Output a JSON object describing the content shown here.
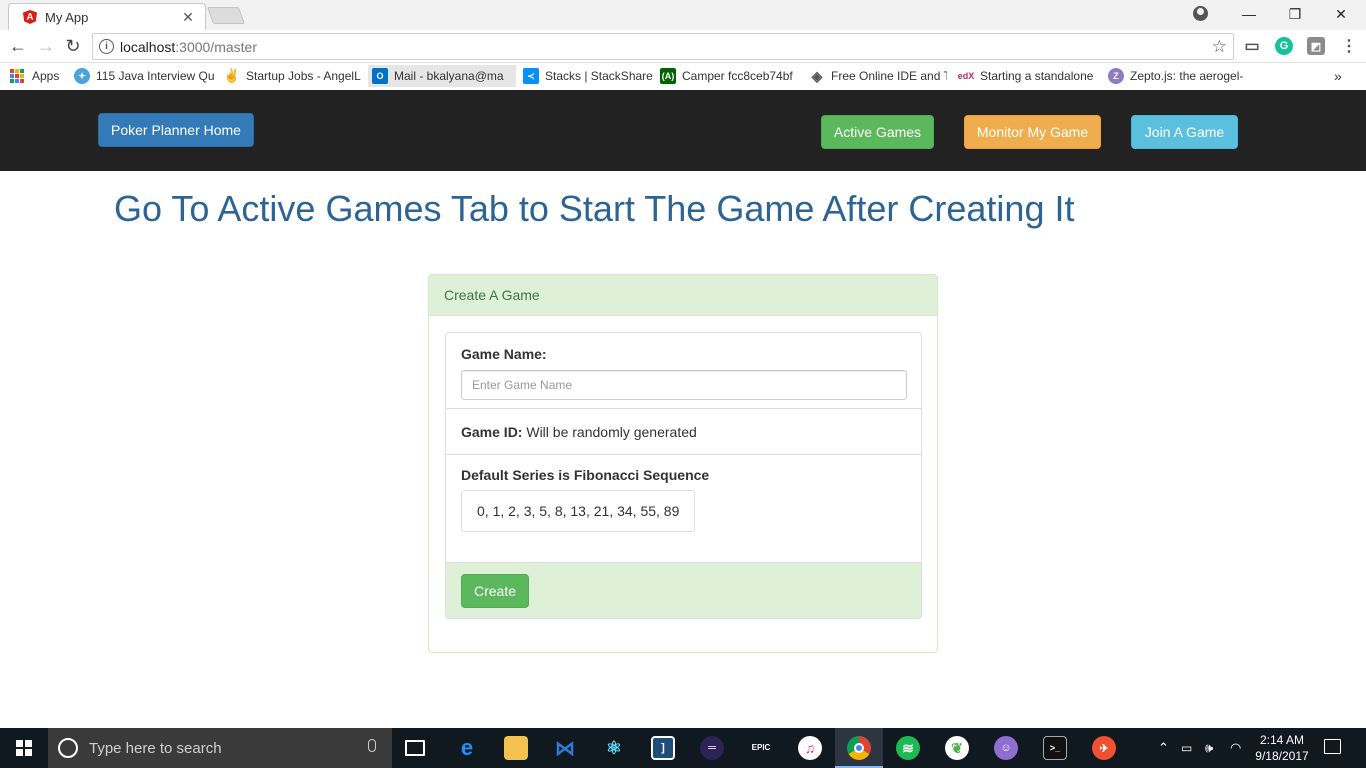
{
  "browser": {
    "tab_title": "My App",
    "tab_close": "✕",
    "url_host": "localhost",
    "url_path": ":3000/master",
    "window_controls": [
      "—",
      "❐",
      "✕"
    ],
    "bookmarks": [
      {
        "label": "Apps",
        "icon": "apps-grid-icon"
      },
      {
        "label": "115 Java Interview Qu",
        "icon": "java-icon",
        "color": "#4aa3df"
      },
      {
        "label": "Startup Jobs - AngelL",
        "icon": "angellist-icon",
        "color": "#333333"
      },
      {
        "label": "Mail - bkalyana@ma",
        "icon": "outlook-icon",
        "color": "#0072c6"
      },
      {
        "label": "Stacks | StackShare",
        "icon": "stackshare-icon",
        "color": "#0690fa"
      },
      {
        "label": "Camper fcc8ceb74bf",
        "icon": "freecodecamp-icon",
        "color": "#006400"
      },
      {
        "label": "Free Online IDE and T",
        "icon": "ide-icon",
        "color": "#555555"
      },
      {
        "label": "Starting a standalone",
        "icon": "edx-icon",
        "color": "#b32b6e"
      },
      {
        "label": "Zepto.js: the aerogel-",
        "icon": "zepto-icon",
        "color": "#8e7cc3"
      }
    ],
    "bookmarks_more": "»"
  },
  "navbar": {
    "home_label": "Poker Planner Home",
    "active_games_label": "Active Games",
    "monitor_label": "Monitor My Game",
    "join_label": "Join A Game"
  },
  "main": {
    "heading": "Go To Active Games Tab to Start The Game After Creating It",
    "panel_title": "Create A Game",
    "game_name_label": "Game Name:",
    "game_name_placeholder": "Enter Game Name",
    "game_name_value": "",
    "game_id_label": "Game ID:",
    "game_id_value": "Will be randomly generated",
    "series_label": "Default Series is Fibonacci Sequence",
    "series_values": "0, 1, 2, 3, 5, 8, 13, 21, 34, 55, 89",
    "create_label": "Create"
  },
  "taskbar": {
    "search_placeholder": "Type here to search",
    "time": "2:14 AM",
    "date": "9/18/2017"
  },
  "colors": {
    "navbar_bg": "#222222",
    "primary": "#337ab7",
    "success": "#5cb85c",
    "warning": "#f0ad4e",
    "info": "#5bc0de",
    "heading": "#2d6494",
    "panel_heading_bg": "#dff0d8"
  }
}
